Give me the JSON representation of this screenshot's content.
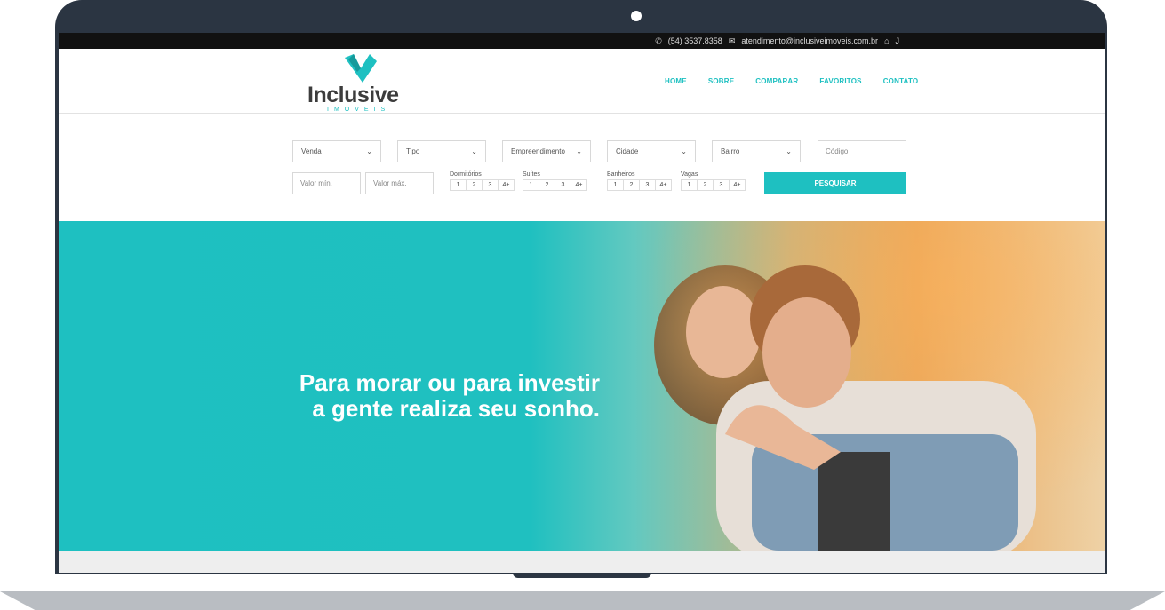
{
  "topbar": {
    "phone": "(54) 3537.8358",
    "email": "atendimento@inclusiveimoveis.com.br",
    "extra": "J"
  },
  "logo": {
    "name": "Inclusive",
    "sub": "IMOVEIS"
  },
  "nav": [
    {
      "label": "HOME"
    },
    {
      "label": "SOBRE"
    },
    {
      "label": "COMPARAR"
    },
    {
      "label": "FAVORITOS"
    },
    {
      "label": "CONTATO"
    }
  ],
  "search": {
    "selects": [
      {
        "label": "Venda"
      },
      {
        "label": "Tipo"
      },
      {
        "label": "Empreendimento"
      },
      {
        "label": "Cidade"
      },
      {
        "label": "Bairro"
      }
    ],
    "codigo_placeholder": "Código",
    "valor_min_placeholder": "Valor mín.",
    "valor_max_placeholder": "Valor máx.",
    "groups": [
      {
        "label": "Dormitórios",
        "options": [
          "1",
          "2",
          "3",
          "4+"
        ]
      },
      {
        "label": "Suítes",
        "options": [
          "1",
          "2",
          "3",
          "4+"
        ]
      },
      {
        "label": "Banheiros",
        "options": [
          "1",
          "2",
          "3",
          "4+"
        ]
      },
      {
        "label": "Vagas",
        "options": [
          "1",
          "2",
          "3",
          "4+"
        ]
      }
    ],
    "button": "PESQUISAR"
  },
  "hero": {
    "line1": "Para morar ou para investir",
    "line2": "a gente realiza seu sonho."
  },
  "colors": {
    "accent": "#1ec0c1",
    "frame": "#2b3542",
    "topbar": "#111111"
  }
}
